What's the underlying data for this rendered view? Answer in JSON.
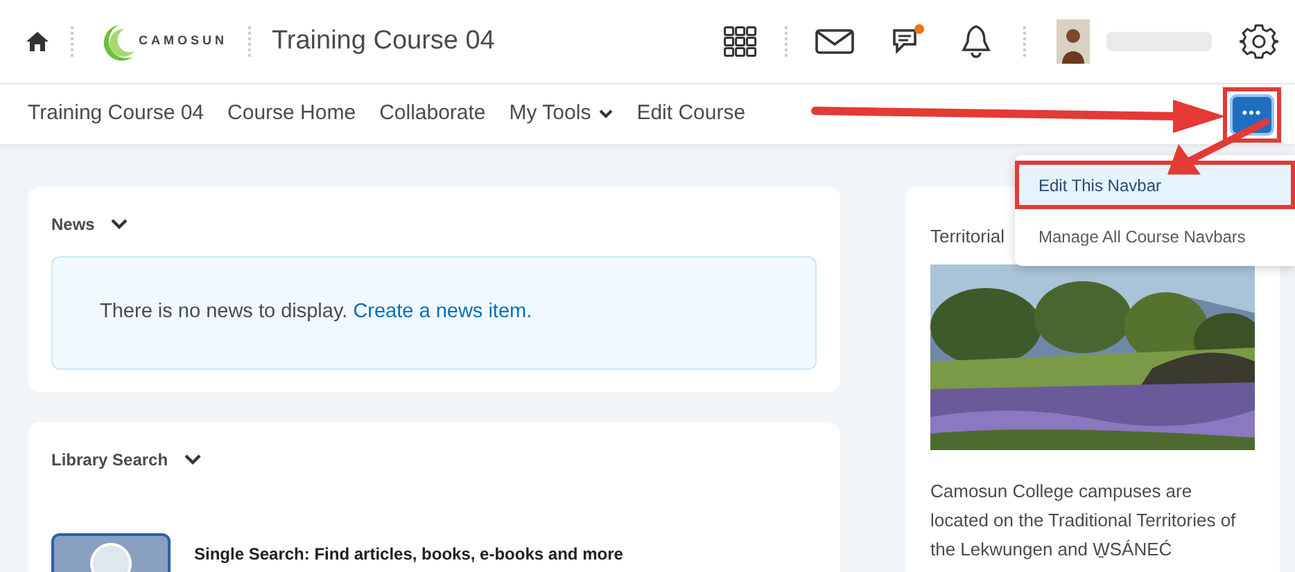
{
  "header": {
    "logo_text": "CAMOSUN",
    "course_title": "Training Course 04",
    "chat_has_alert": true
  },
  "navbar": {
    "items": [
      {
        "label": "Training Course 04",
        "has_menu": false
      },
      {
        "label": "Course Home",
        "has_menu": false
      },
      {
        "label": "Collaborate",
        "has_menu": false
      },
      {
        "label": "My Tools",
        "has_menu": true
      },
      {
        "label": "Edit Course",
        "has_menu": false
      }
    ],
    "more_button": "•••"
  },
  "more_menu": {
    "open": true,
    "items": [
      {
        "label": "Edit This Navbar",
        "selected": true
      },
      {
        "label": "Manage All Course Navbars",
        "selected": false
      }
    ]
  },
  "news": {
    "title": "News",
    "message": "There is no news to display.",
    "link": "Create a news item."
  },
  "library": {
    "title": "Library Search",
    "item": "Single Search: Find articles, books, e-books and more"
  },
  "territorial": {
    "title": "Territorial",
    "text": "Camosun College campuses are located on the Traditional Territories of the Lekwungen and W̱SÁNEĆ"
  }
}
